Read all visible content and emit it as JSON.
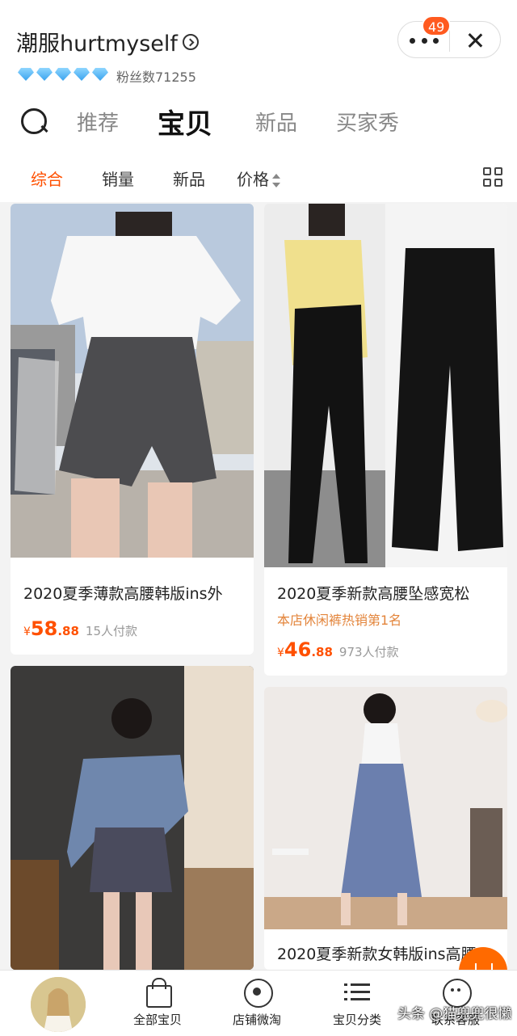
{
  "shop": {
    "name": "潮服hurtmyself",
    "fans": "粉丝数71255",
    "diamond_count": 5
  },
  "capsule": {
    "badge": "49"
  },
  "tabs": [
    {
      "label": "推荐"
    },
    {
      "label": "宝贝",
      "active": true
    },
    {
      "label": "新品"
    },
    {
      "label": "买家秀"
    }
  ],
  "sort": {
    "items": [
      "综合",
      "销量",
      "新品",
      "价格"
    ],
    "active": "综合"
  },
  "products": [
    {
      "title": "2020夏季薄款高腰韩版ins外",
      "tag": "",
      "currency": "¥",
      "price_int": "58",
      "price_dec": ".88",
      "sold": "15人付款"
    },
    {
      "title": "2020夏季新款高腰坠感宽松",
      "tag": "本店休闲裤热销第1名",
      "currency": "¥",
      "price_int": "46",
      "price_dec": ".88",
      "sold": "973人付款"
    },
    {
      "title": "",
      "tag": "",
      "currency": "",
      "price_int": "",
      "price_dec": "",
      "sold": ""
    },
    {
      "title": "2020夏季新款女韩版ins高腰",
      "tag": "",
      "currency": "",
      "price_int": "",
      "price_dec": "",
      "sold": ""
    }
  ],
  "bottom_nav": [
    {
      "label": "全部宝贝",
      "icon": "bag-icon"
    },
    {
      "label": "店铺微淘",
      "icon": "broadcast-icon"
    },
    {
      "label": "宝贝分类",
      "icon": "list-icon"
    },
    {
      "label": "联系客服",
      "icon": "service-face-icon"
    }
  ],
  "watermark": "头条 @猫兜兜很懒",
  "colors": {
    "accent": "#ff5000",
    "badge": "#ff5a1f",
    "tag": "#e3843a"
  }
}
